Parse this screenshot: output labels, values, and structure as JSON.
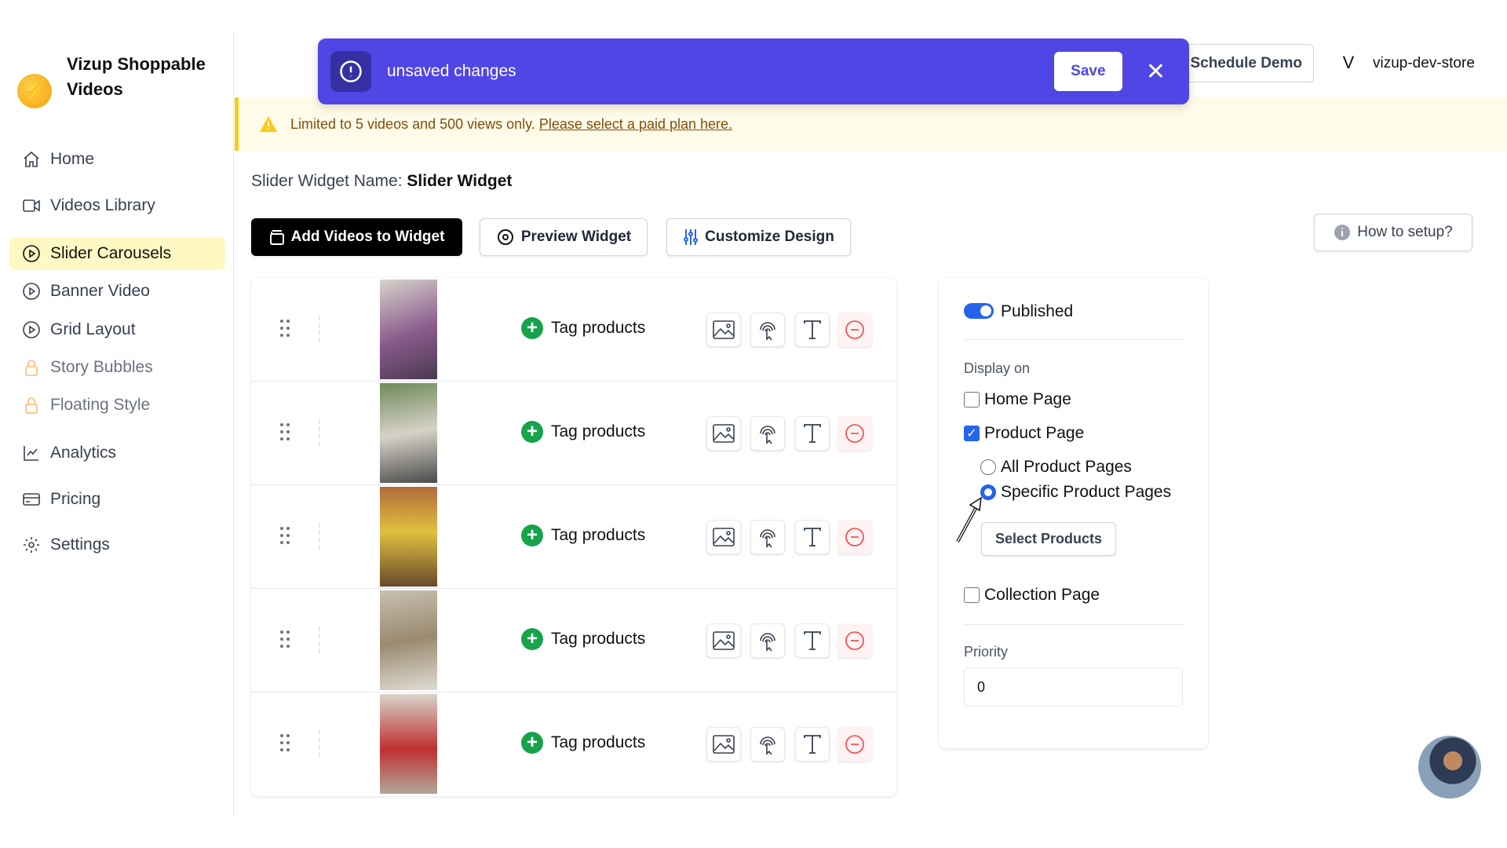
{
  "app": {
    "name": "Vizup Shoppable Videos",
    "logo_icon": "lightning-icon"
  },
  "sidebar": {
    "items": [
      {
        "label": "Home",
        "icon": "home-icon"
      },
      {
        "label": "Videos Library",
        "icon": "video-icon"
      },
      {
        "label": "Slider Carousels",
        "icon": "play-circle-icon",
        "active": true
      },
      {
        "label": "Banner Video",
        "icon": "play-circle-icon"
      },
      {
        "label": "Grid Layout",
        "icon": "play-circle-icon"
      },
      {
        "label": "Story Bubbles",
        "icon": "lock-icon",
        "locked": true
      },
      {
        "label": "Floating Style",
        "icon": "lock-icon",
        "locked": true
      },
      {
        "label": "Analytics",
        "icon": "chart-icon"
      },
      {
        "label": "Pricing",
        "icon": "credit-card-icon"
      },
      {
        "label": "Settings",
        "icon": "gear-icon"
      }
    ]
  },
  "toast": {
    "message": "unsaved changes",
    "save_label": "Save",
    "color": "#4f46e5"
  },
  "header": {
    "schedule_demo": "Schedule Demo",
    "avatar_letter": "V",
    "store": "vizup-dev-store"
  },
  "warning": {
    "text": "Limited to 5 videos and 500 views only.",
    "link": "Please select a paid plan here."
  },
  "widget": {
    "name_label": "Slider Widget Name:",
    "name": "Slider Widget"
  },
  "toolbar": {
    "add_videos": "Add Videos to Widget",
    "preview": "Preview Widget",
    "customize": "Customize Design",
    "how_to": "How to setup?"
  },
  "videos": [
    {
      "tag_label": "Tag products"
    },
    {
      "tag_label": "Tag products"
    },
    {
      "tag_label": "Tag products"
    },
    {
      "tag_label": "Tag products"
    },
    {
      "tag_label": "Tag products"
    }
  ],
  "panel": {
    "published_label": "Published",
    "published": true,
    "display_on": "Display on",
    "home_page": "Home Page",
    "product_page": "Product Page",
    "all_product_pages": "All Product Pages",
    "specific_product_pages": "Specific Product Pages",
    "select_products": "Select Products",
    "collection_page": "Collection Page",
    "priority_label": "Priority",
    "priority_value": "0"
  }
}
